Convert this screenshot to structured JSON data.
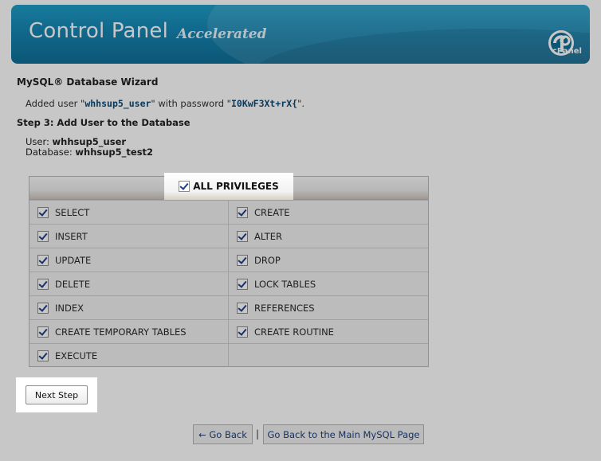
{
  "banner": {
    "title": "Control Panel",
    "subtitle": "Accelerated",
    "logo_text": "cPanel",
    "logo_icon": "cpanel-logo-icon"
  },
  "wizard": {
    "heading": "MySQL® Database Wizard",
    "added_prefix": "Added user \"",
    "added_user": "whhsup5_user",
    "added_middle": "\" with password \"",
    "added_password": "I0KwF3Xt+rX{",
    "added_suffix": "\".",
    "step_heading": "Step 3: Add User to the Database",
    "user_label": "User:",
    "user_value": "whhsup5_user",
    "database_label": "Database:",
    "database_value": "whhsup5_test2"
  },
  "privileges": {
    "all_label": "ALL PRIVILEGES",
    "all_checked": true,
    "items": [
      {
        "label": "SELECT",
        "checked": true
      },
      {
        "label": "CREATE",
        "checked": true
      },
      {
        "label": "INSERT",
        "checked": true
      },
      {
        "label": "ALTER",
        "checked": true
      },
      {
        "label": "UPDATE",
        "checked": true
      },
      {
        "label": "DROP",
        "checked": true
      },
      {
        "label": "DELETE",
        "checked": true
      },
      {
        "label": "LOCK TABLES",
        "checked": true
      },
      {
        "label": "INDEX",
        "checked": true
      },
      {
        "label": "REFERENCES",
        "checked": true
      },
      {
        "label": "CREATE TEMPORARY TABLES",
        "checked": true
      },
      {
        "label": "CREATE ROUTINE",
        "checked": true
      },
      {
        "label": "EXECUTE",
        "checked": true
      }
    ]
  },
  "actions": {
    "next_step": "Next Step",
    "go_back": "← Go Back",
    "separator": "|",
    "main_mysql": "Go Back to the Main MySQL Page"
  },
  "colors": {
    "banner": "#1686b3",
    "link": "#1e3f7a",
    "highlight": "#ffffff"
  }
}
